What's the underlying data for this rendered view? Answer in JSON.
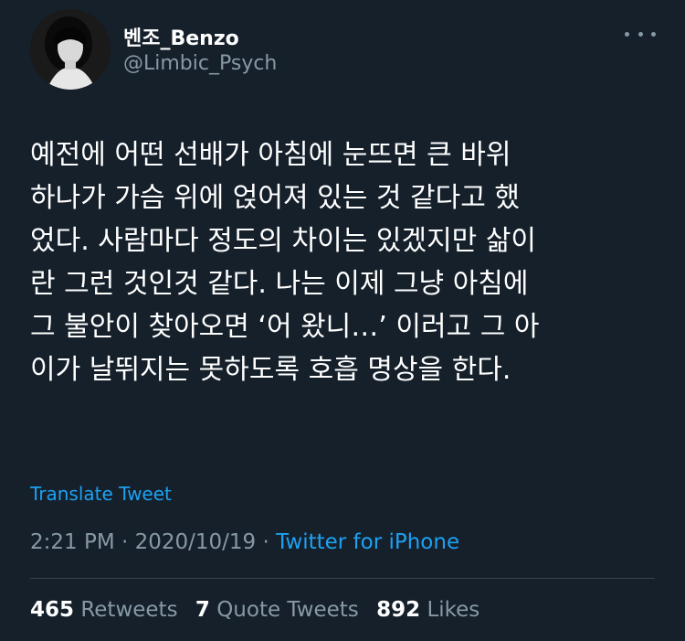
{
  "author": {
    "display_name": "벤조_Benzo",
    "handle": "@Limbic_Psych"
  },
  "tweet": {
    "lines": [
      "예전에 어떤 선배가 아침에 눈뜨면 큰 바위",
      "하나가 가슴 위에 얹어져 있는 것 같다고 했",
      "었다. 사람마다 정도의 차이는 있겠지만 삶이",
      "란 그런 것인것 같다. 나는 이제 그냥 아침에",
      "그 불안이 찾아오면 ‘어 왔니…’ 이러고 그 아",
      "이가 날뛰지는 못하도록 호흡 명상을 한다."
    ],
    "translate_label": "Translate Tweet",
    "time": "2:21 PM",
    "separator": "·",
    "date": "2020/10/19",
    "source": "Twitter for iPhone"
  },
  "stats": {
    "retweets_count": "465",
    "retweets_label": "Retweets",
    "quotes_count": "7",
    "quotes_label": "Quote Tweets",
    "likes_count": "892",
    "likes_label": "Likes"
  },
  "icons": {
    "more": "more-dots-icon"
  },
  "colors": {
    "background": "#15202b",
    "accent": "#1da1f2",
    "secondary_text": "#8899a6",
    "divider": "#38444d"
  }
}
